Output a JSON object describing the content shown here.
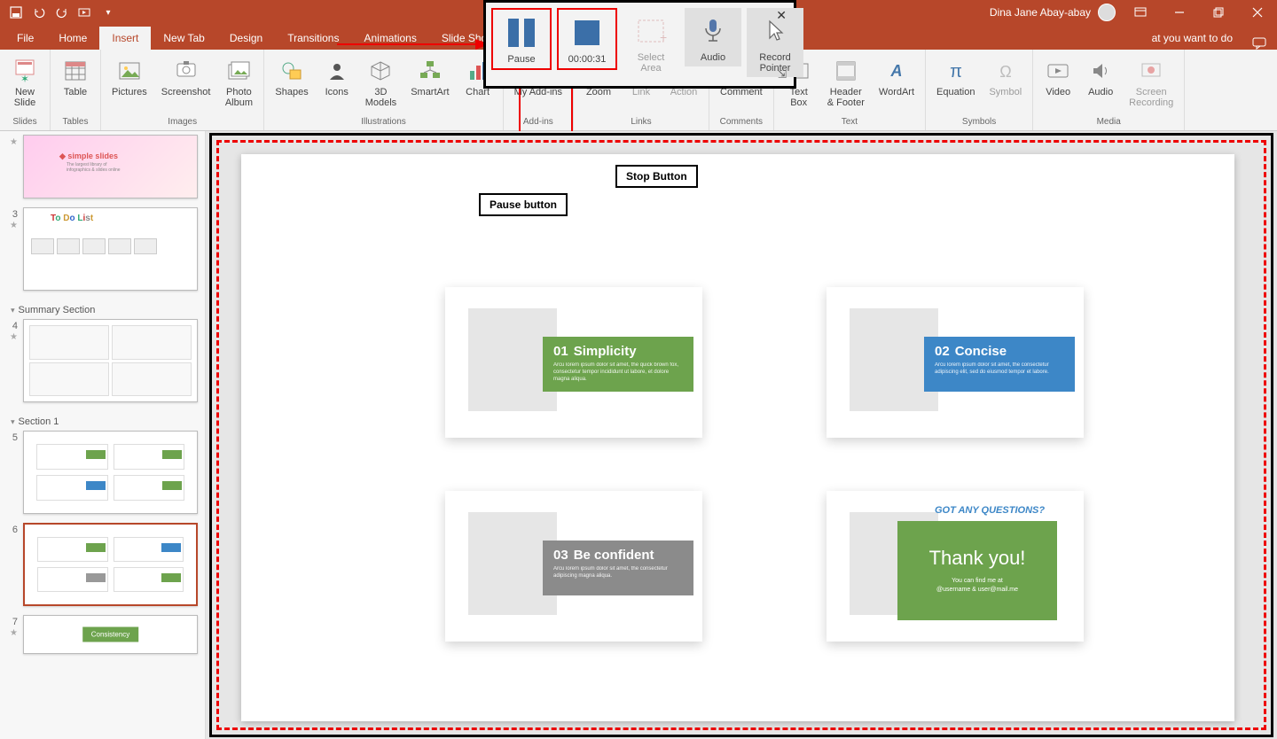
{
  "title_user": "Dina Jane Abay-abay",
  "ribbon_tabs": [
    "File",
    "Home",
    "Insert",
    "New Tab",
    "Design",
    "Transitions",
    "Animations",
    "Slide Show"
  ],
  "active_tab": "Insert",
  "tell_me": "at you want to do",
  "ribbon": {
    "groups": [
      {
        "label": "Slides",
        "buttons": [
          {
            "name": "New\nSlide",
            "dn": "new-slide-button"
          }
        ]
      },
      {
        "label": "Tables",
        "buttons": [
          {
            "name": "Table",
            "dn": "table-button"
          }
        ]
      },
      {
        "label": "Images",
        "buttons": [
          {
            "name": "Pictures",
            "dn": "pictures-button"
          },
          {
            "name": "Screenshot",
            "dn": "screenshot-button"
          },
          {
            "name": "Photo\nAlbum",
            "dn": "photo-album-button"
          }
        ]
      },
      {
        "label": "Illustrations",
        "buttons": [
          {
            "name": "Shapes",
            "dn": "shapes-button"
          },
          {
            "name": "Icons",
            "dn": "icons-button"
          },
          {
            "name": "3D\nModels",
            "dn": "3d-models-button"
          },
          {
            "name": "SmartArt",
            "dn": "smartart-button"
          },
          {
            "name": "Chart",
            "dn": "chart-button"
          }
        ]
      },
      {
        "label": "Add-ins",
        "buttons": [
          {
            "name": "My Add-ins",
            "dn": "my-addins-button"
          }
        ]
      },
      {
        "label": "Links",
        "buttons": [
          {
            "name": "Zoom",
            "dn": "zoom-button"
          },
          {
            "name": "Link",
            "dn": "link-button",
            "disabled": true
          },
          {
            "name": "Action",
            "dn": "action-button",
            "disabled": true
          }
        ]
      },
      {
        "label": "Comments",
        "buttons": [
          {
            "name": "Comment",
            "dn": "comment-button"
          }
        ]
      },
      {
        "label": "Text",
        "buttons": [
          {
            "name": "Text\nBox",
            "dn": "text-box-button"
          },
          {
            "name": "Header\n& Footer",
            "dn": "header-footer-button"
          },
          {
            "name": "WordArt",
            "dn": "wordart-button"
          }
        ]
      },
      {
        "label": "Symbols",
        "buttons": [
          {
            "name": "Equation",
            "dn": "equation-button"
          },
          {
            "name": "Symbol",
            "dn": "symbol-button",
            "disabled": true
          }
        ]
      },
      {
        "label": "Media",
        "buttons": [
          {
            "name": "Video",
            "dn": "video-button"
          },
          {
            "name": "Audio",
            "dn": "audio-button"
          },
          {
            "name": "Screen\nRecording",
            "dn": "screen-recording-button",
            "disabled": true
          }
        ]
      }
    ]
  },
  "rec": {
    "pause": "Pause",
    "timer": "00:00:31",
    "select_area": "Select\nArea",
    "audio": "Audio",
    "record_pointer": "Record\nPointer"
  },
  "annotations": {
    "pause": "Pause button",
    "stop": "Stop Button"
  },
  "sections": [
    {
      "name": "Summary Section"
    },
    {
      "name": "Section 1"
    }
  ],
  "thumb_numbers": [
    "3",
    "4",
    "5",
    "6",
    "7"
  ],
  "slide": {
    "c1": {
      "num": "01",
      "title": "Simplicity",
      "body": "Arcu lorem ipsum dolor sit amet, the quick brown fox, consectetur tempor incididunt ut labore, et dolore magna aliqua."
    },
    "c2": {
      "num": "02",
      "title": "Concise",
      "body": "Arcu lorem ipsum dolor sit amet, the consectetur adipiscing elit, sed do eiusmod tempor et labore."
    },
    "c3": {
      "num": "03",
      "title": "Be confident",
      "body": "Arcu lorem ipsum dolor sit amet, the consectetur adipiscing magna aliqua."
    },
    "c4": {
      "question": "GOT ANY QUESTIONS?",
      "thanks": "Thank you!",
      "find": "You can find me at",
      "handle": "@username & user@mail.me"
    }
  },
  "thumb7_label": "Consistency"
}
